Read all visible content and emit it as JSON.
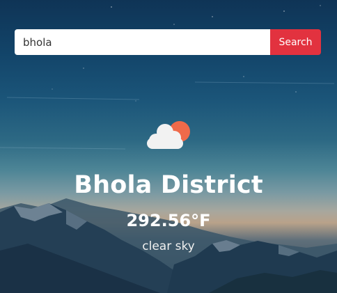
{
  "search": {
    "value": "bhola",
    "button_label": "Search"
  },
  "weather": {
    "icon": "cloud-sun-icon",
    "city": "Bhola District",
    "temperature": "292.56°F",
    "description": "clear sky"
  },
  "colors": {
    "search_button": "#e2323f",
    "sun": "#ef6a4a",
    "cloud": "#f2f2f2",
    "text": "#ffffff"
  }
}
